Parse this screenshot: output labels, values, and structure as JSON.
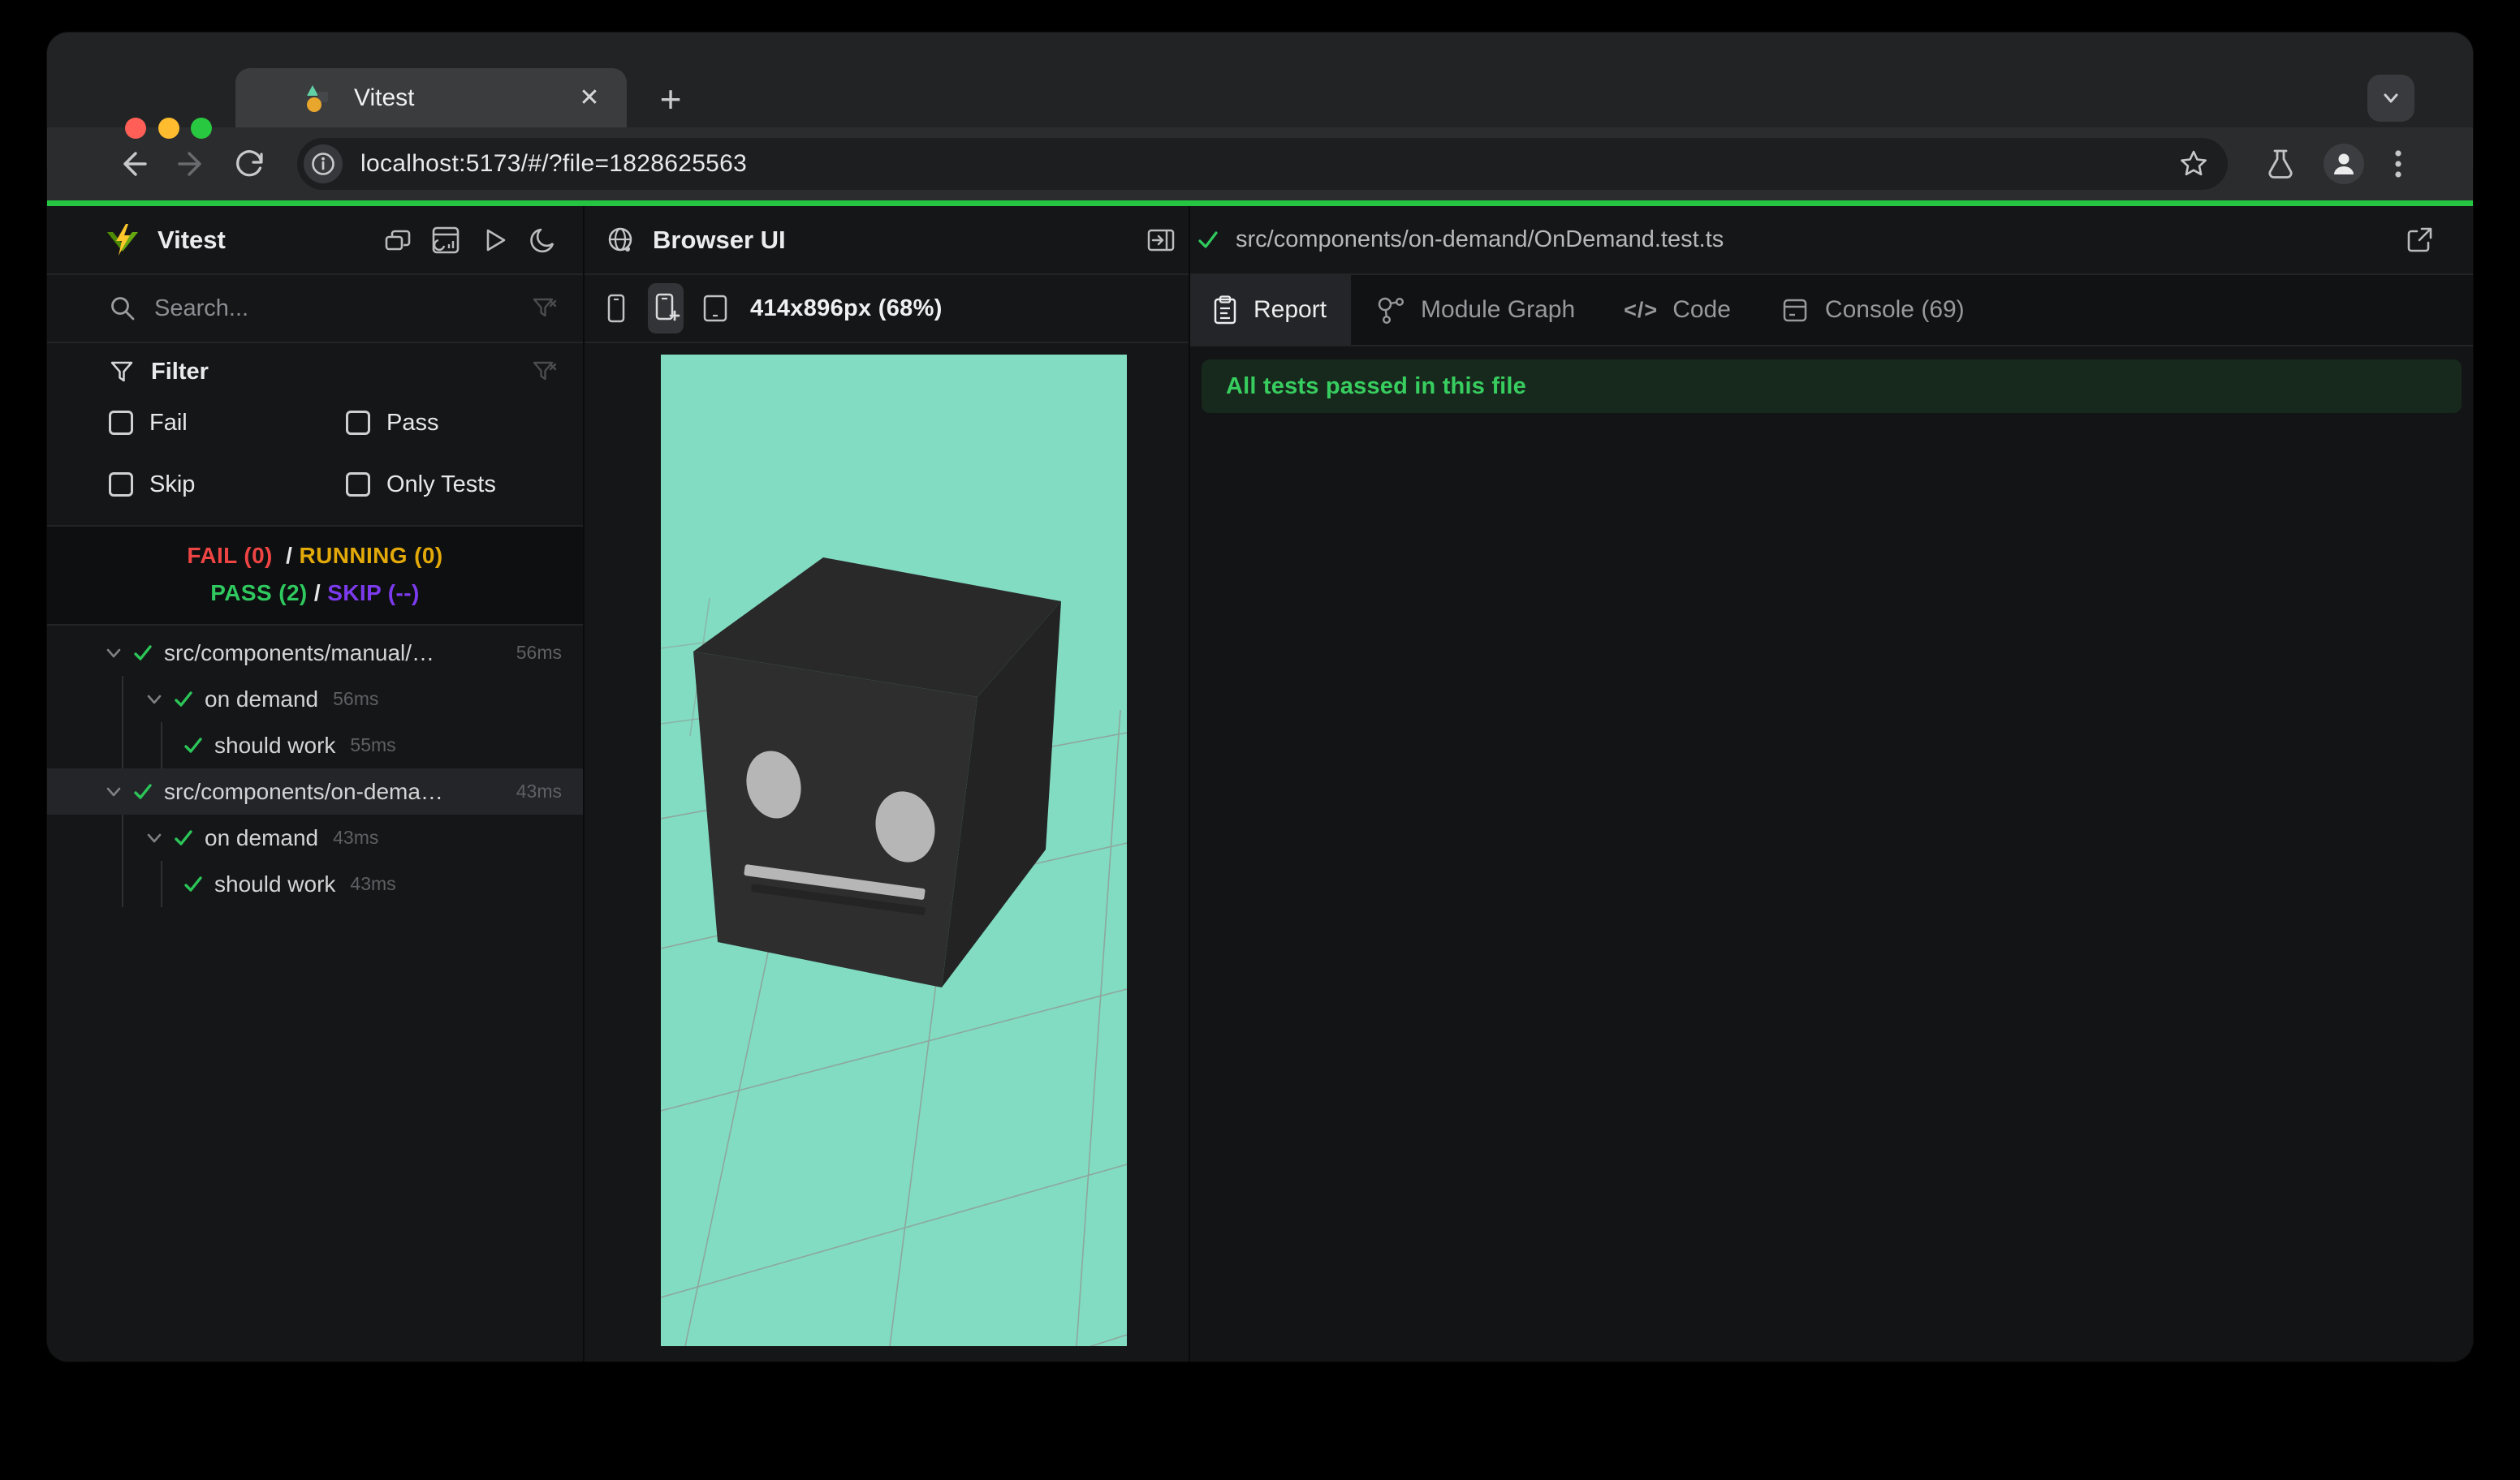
{
  "browser": {
    "tab_title": "Vitest",
    "close_glyph": "✕",
    "new_tab_glyph": "+",
    "url": "localhost:5173/#/?file=1828625563"
  },
  "sidebar": {
    "title": "Vitest",
    "search_placeholder": "Search...",
    "filter": {
      "label": "Filter",
      "options": [
        "Fail",
        "Pass",
        "Skip",
        "Only Tests"
      ]
    },
    "stats": {
      "fail": "FAIL (0)",
      "running": "RUNNING (0)",
      "pass": "PASS (2)",
      "skip": "SKIP (--)",
      "separator": "/"
    },
    "tree": [
      {
        "name": "src/components/manual/…",
        "duration": "56ms",
        "level": 0
      },
      {
        "name": "on demand",
        "duration": "56ms",
        "level": 1
      },
      {
        "name": "should work",
        "duration": "55ms",
        "level": 2
      },
      {
        "name": "src/components/on-dema…",
        "duration": "43ms",
        "level": 0,
        "selected": true
      },
      {
        "name": "on demand",
        "duration": "43ms",
        "level": 1
      },
      {
        "name": "should work",
        "duration": "43ms",
        "level": 2
      }
    ]
  },
  "browser_panel": {
    "title": "Browser UI",
    "viewport_label": "414x896px (68%)"
  },
  "report_panel": {
    "file_path": "src/components/on-demand/OnDemand.test.ts",
    "tabs": [
      {
        "label": "Report",
        "active": true
      },
      {
        "label": "Module Graph",
        "active": false
      },
      {
        "label": "Code",
        "active": false
      },
      {
        "label": "Console (69)",
        "active": false
      }
    ],
    "code_tab_glyph": "</>",
    "banner": "All tests passed in this file"
  },
  "colors": {
    "progress_green": "#26c541",
    "pass_green": "#2fc95f",
    "fail_red": "#ef4444",
    "running_yellow": "#e2a909",
    "skip_purple": "#7c3aed",
    "viewport_background": "#82dcc2",
    "cube": "#2d2d2f",
    "banner_background": "#17291d"
  }
}
